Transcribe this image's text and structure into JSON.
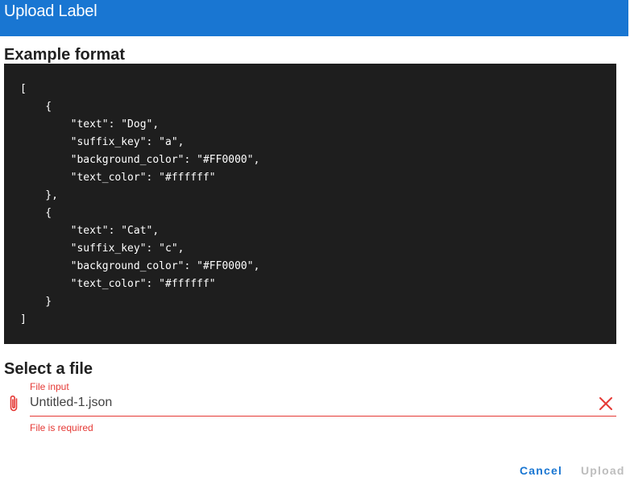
{
  "dialog": {
    "title": "Upload Label"
  },
  "example_section": {
    "heading": "Example format",
    "code": "[\n    {\n        \"text\": \"Dog\",\n        \"suffix_key\": \"a\",\n        \"background_color\": \"#FF0000\",\n        \"text_color\": \"#ffffff\"\n    },\n    {\n        \"text\": \"Cat\",\n        \"suffix_key\": \"c\",\n        \"background_color\": \"#FF0000\",\n        \"text_color\": \"#ffffff\"\n    }\n]"
  },
  "file_section": {
    "heading": "Select a file",
    "input_label": "File input",
    "input_value": "Untitled-1.json",
    "error_message": "File is required",
    "prepend_icon": "paperclip-icon",
    "clear_icon": "close-icon"
  },
  "actions": {
    "cancel_label": "Cancel",
    "upload_label": "Upload"
  },
  "colors": {
    "primary": "#1976d2",
    "error": "#e53935",
    "code_background": "#1e1e1e",
    "disabled": "#bdbdbd"
  }
}
